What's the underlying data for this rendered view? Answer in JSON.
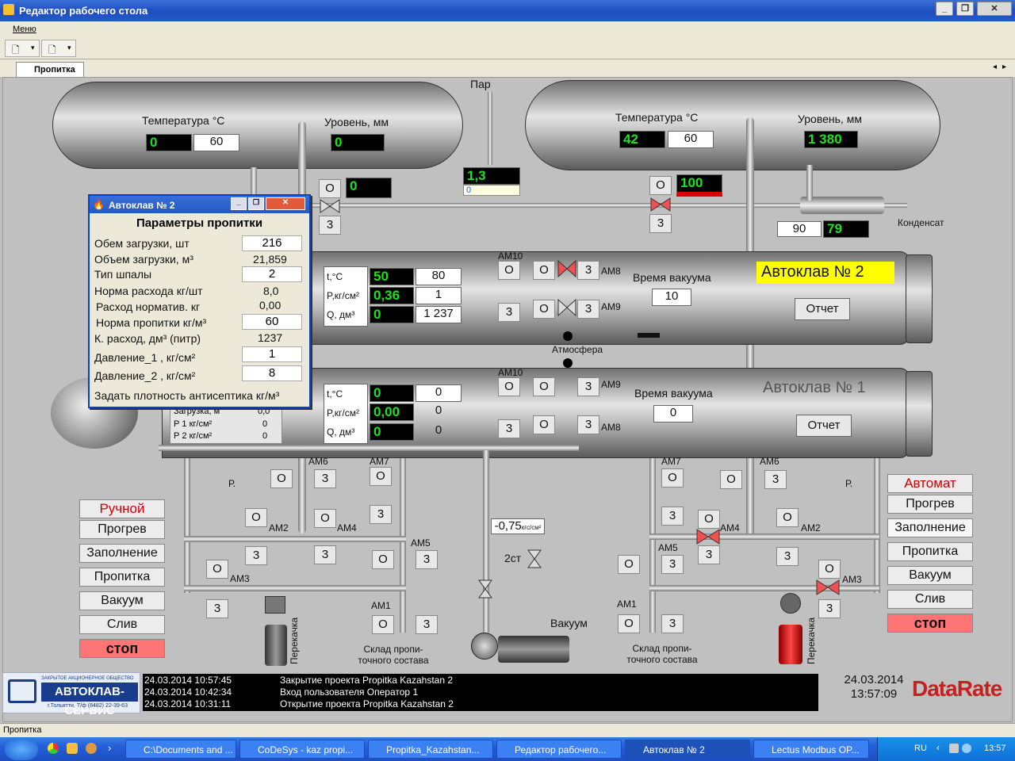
{
  "window": {
    "title": "Редактор рабочего стола"
  },
  "menu": {
    "label": "Меню"
  },
  "tab": {
    "label": "Пропитка"
  },
  "steam": {
    "label": "Пар",
    "value": "1,3",
    "sub": "0"
  },
  "tank_left": {
    "temp_label": "Температура",
    "temp_unit": "°С",
    "temp_value": "0",
    "temp_set": "60",
    "level_label": "Уровень, мм",
    "level_value": "0"
  },
  "tank_right": {
    "temp_label": "Температура",
    "temp_unit": "°С",
    "temp_value": "42",
    "temp_set": "60",
    "level_label": "Уровень, мм",
    "level_value": "1 380"
  },
  "valve_left_top": {
    "o": "О",
    "three": "3",
    "value": "0"
  },
  "valve_right_top": {
    "o": "О",
    "three": "3",
    "value": "100"
  },
  "condensate": {
    "label": "Конденсат",
    "set": "90",
    "value": "79"
  },
  "autoclave2": {
    "name": "Автоклав № 2",
    "report": "Отчет",
    "vacuum_label": "Время вакуума",
    "vacuum_value": "10",
    "params": [
      {
        "label": "t,°C",
        "value": "50",
        "set": "80"
      },
      {
        "label": "P,кг/см²",
        "value": "0,36",
        "set": "1"
      },
      {
        "label": "Q, дм³",
        "value": "0",
        "set": "1 237"
      }
    ],
    "valves": [
      "AM10",
      "AM8",
      "AM9"
    ]
  },
  "autoclave1": {
    "name": "Автоклав № 1",
    "report": "Отчет",
    "vacuum_label": "Время вакуума",
    "vacuum_value": "0",
    "params": [
      {
        "label": "t,°C",
        "value": "0",
        "set": "0"
      },
      {
        "label": "P,кг/см²",
        "value": "0,00",
        "set": "0"
      },
      {
        "label": "Q, дм³",
        "value": "0",
        "set": "0"
      }
    ],
    "valves": [
      "AM10",
      "AM9",
      "AM8"
    ]
  },
  "atmosphere": {
    "label": "Атмосфера"
  },
  "vacuum": {
    "label": "Вакуум",
    "pressure": "-0,75",
    "pressure_unit": "кгс/см²",
    "valve": "2ст"
  },
  "hidden_panel": {
    "rows": [
      "Загрузка, м",
      "Р  1  кг/см²",
      "Р  2 кг/см²"
    ],
    "values": [
      "0,0",
      "0",
      "0"
    ]
  },
  "valve_labels": {
    "am1": "AM1",
    "am2": "AM2",
    "am3": "AM3",
    "am4": "AM4",
    "am5": "AM5",
    "am6": "AM6",
    "am7": "AM7",
    "p": "Р."
  },
  "pump": {
    "label": "Перекачка"
  },
  "storage": {
    "label": "Склад пропи-точного состава"
  },
  "manual_mode": {
    "header": "Ручной",
    "buttons": [
      "Прогрев",
      "Заполнение",
      "Пропитка",
      "Вакуум",
      "Слив"
    ],
    "stop": "стоп"
  },
  "auto_mode": {
    "header": "Автомат",
    "buttons": [
      "Прогрев",
      "Заполнение",
      "Пропитка",
      "Вакуум",
      "Слив"
    ],
    "stop": "стоп"
  },
  "dialog": {
    "title": "Автоклав № 2",
    "header": "Параметры пропитки",
    "rows": [
      {
        "label": "Обем загрузки, шт",
        "value": "216",
        "editable": true
      },
      {
        "label": "Объем загрузки, м³",
        "value": "21,859",
        "editable": false
      },
      {
        "label": "Тип шпалы",
        "value": "2",
        "editable": true
      },
      {
        "label": "Норма расхода  кг/шт",
        "value": "8,0",
        "editable": false
      },
      {
        "label": "Расход норматив. кг",
        "value": "0,00",
        "editable": false
      },
      {
        "label": "Норма пропитки кг/м³",
        "value": "60",
        "editable": true
      },
      {
        "label": "К. расход, дм³ (питр)",
        "value": "1237",
        "editable": false
      },
      {
        "label": "Давление_1 , кг/см²",
        "value": "1",
        "editable": true
      },
      {
        "label": "Давление_2 , кг/см²",
        "value": "8",
        "editable": true
      }
    ],
    "footer": "Задать плотность антисептика кг/м³"
  },
  "log": [
    {
      "time": "24.03.2014 10:57:45",
      "msg": "Закрытие проекта Propitka  Kazahstan  2"
    },
    {
      "time": "24.03.2014 10:42:34",
      "msg": "Вход пользователя Оператор  1"
    },
    {
      "time": "24.03.2014 10:31:11",
      "msg": "Открытие проекта Propitka  Kazahstan  2"
    }
  ],
  "clock": {
    "date": "24.03.2014",
    "time": "13:57:09"
  },
  "brand": {
    "datarate": "DataRate",
    "company_top": "ЗАКРЫТОЕ АКЦИОНЕРНОЕ ОБЩЕСТВО",
    "company": "АВТОКЛАВ-СЕРВИС",
    "company_sub": "г.Тольятти, Т/ф (8482) 22-39-63"
  },
  "statusbar": {
    "text": "Пропитка"
  },
  "taskbar": {
    "items": [
      "C:\\Documents and ...",
      "CoDeSys - kaz propi...",
      "Propitka_Kazahstan...",
      "Редактор рабочего...",
      "Автоклав № 2",
      "Lectus Modbus OP..."
    ],
    "lang": "RU",
    "time": "13:57"
  },
  "colors": {
    "display_bg": "#000000",
    "display_fg": "#19e619",
    "stop": "#ff7575",
    "autoclave_label_bg": "#ffff00",
    "mode_header": "#d00000"
  }
}
